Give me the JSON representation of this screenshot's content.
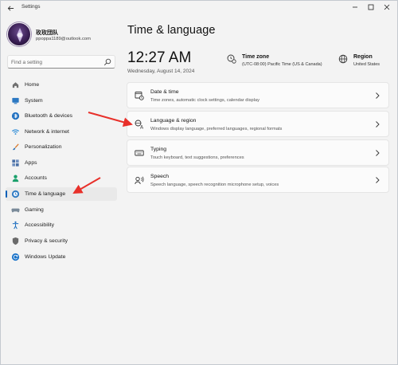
{
  "window": {
    "title": "Settings"
  },
  "profile": {
    "name": "玫玫団队",
    "email": "ppoppa1189@outlook.com"
  },
  "search": {
    "placeholder": "Find a setting"
  },
  "sidebar": {
    "items": [
      {
        "label": "Home",
        "icon": "home-icon",
        "color": "#6b6b6b"
      },
      {
        "label": "System",
        "icon": "monitor-icon",
        "color": "#2b78c2"
      },
      {
        "label": "Bluetooth & devices",
        "icon": "bluetooth-icon",
        "color": "#1f6fc0"
      },
      {
        "label": "Network & internet",
        "icon": "wifi-icon",
        "color": "#2a8ad6"
      },
      {
        "label": "Personalization",
        "icon": "brush-icon",
        "color": "#d9772a"
      },
      {
        "label": "Apps",
        "icon": "apps-icon",
        "color": "#4a6fa5"
      },
      {
        "label": "Accounts",
        "icon": "person-icon",
        "color": "#1aa06b"
      },
      {
        "label": "Time & language",
        "icon": "globe-clock-icon",
        "color": "#2b78c2",
        "active": true
      },
      {
        "label": "Gaming",
        "icon": "gamepad-icon",
        "color": "#7a8a99"
      },
      {
        "label": "Accessibility",
        "icon": "accessibility-icon",
        "color": "#1f6fc0"
      },
      {
        "label": "Privacy & security",
        "icon": "shield-icon",
        "color": "#6b6b6b"
      },
      {
        "label": "Windows Update",
        "icon": "update-icon",
        "color": "#1a73c9"
      }
    ]
  },
  "main": {
    "title": "Time & language",
    "clock": "12:27 AM",
    "date": "Wednesday, August 14, 2024",
    "timezone": {
      "label": "Time zone",
      "value": "(UTC-08:00) Pacific Time (US & Canada)"
    },
    "region": {
      "label": "Region",
      "value": "United States"
    },
    "cards": [
      {
        "title": "Date & time",
        "desc": "Time zones, automatic clock settings, calendar display",
        "icon": "calendar-clock-icon"
      },
      {
        "title": "Language & region",
        "desc": "Windows display language, preferred languages, regional formats",
        "icon": "language-icon"
      },
      {
        "title": "Typing",
        "desc": "Touch keyboard, text suggestions, preferences",
        "icon": "keyboard-icon"
      },
      {
        "title": "Speech",
        "desc": "Speech language, speech recognition microphone setup, voices",
        "icon": "speech-icon"
      }
    ]
  },
  "colors": {
    "accent": "#005fb8",
    "annotation_arrow": "#e8302a"
  }
}
